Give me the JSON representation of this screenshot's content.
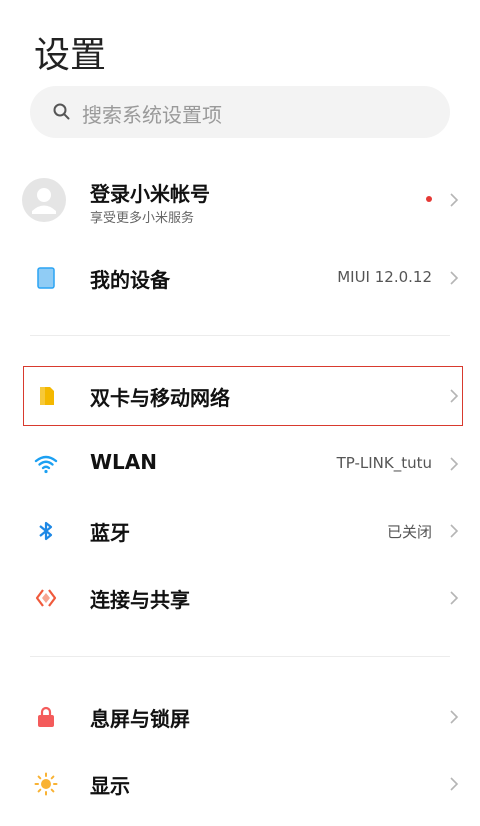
{
  "page": {
    "title": "设置"
  },
  "search": {
    "placeholder": "搜索系统设置项",
    "icon": "search-icon"
  },
  "account": {
    "name": "登录小米帐号",
    "subtitle": "享受更多小米服务",
    "icon": "avatar-icon"
  },
  "items": [
    {
      "label": "我的设备",
      "value": "MIUI 12.0.12",
      "icon": "device-icon",
      "icon_color": "#2aa4f4"
    },
    {
      "label": "双卡与移动网络",
      "value": "",
      "icon": "sim-card-icon",
      "icon_color": "#f4b800",
      "highlighted": true
    },
    {
      "label": "WLAN",
      "value": "TP-LINK_tutu",
      "icon": "wifi-icon",
      "icon_color": "#1ca0f2"
    },
    {
      "label": "蓝牙",
      "value": "已关闭",
      "icon": "bluetooth-icon",
      "icon_color": "#1e88e5"
    },
    {
      "label": "连接与共享",
      "value": "",
      "icon": "connection-share-icon",
      "icon_color": "#f05a3c"
    },
    {
      "label": "息屏与锁屏",
      "value": "",
      "icon": "lock-icon",
      "icon_color": "#f45b5b"
    },
    {
      "label": "显示",
      "value": "",
      "icon": "sun-icon",
      "icon_color": "#f9b233"
    }
  ],
  "colors": {
    "highlight_border": "#d83a2e",
    "notification_dot": "#e53935"
  }
}
